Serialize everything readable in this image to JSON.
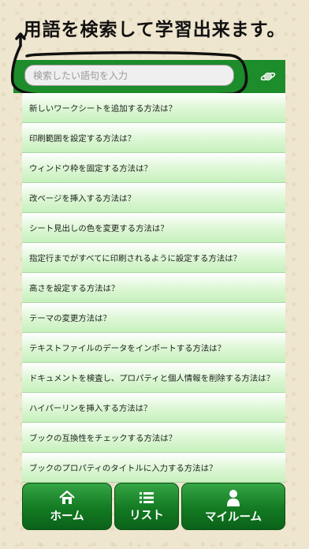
{
  "headline": "用語を検索して学習出来ます。",
  "search": {
    "placeholder": "検索したい語句を入力",
    "button_icon": "planet-icon"
  },
  "items": [
    "新しいワークシートを追加する方法は？",
    "印刷範囲を設定する方法は？",
    "ウィンドウ枠を固定する方法は？",
    "改ページを挿入する方法は？",
    "シート見出しの色を変更する方法は？",
    "指定行までがすべてに印刷されるように設定する方法は？",
    "高さを設定する方法は？",
    "テーマの変更方法は？",
    "テキストファイルのデータをインポートする方法は？",
    "ドキュメントを検査し、プロパティと個人情報を削除する方法は？",
    "ハイパーリンを挿入する方法は？",
    "ブックの互換性をチェックする方法は？",
    "ブックのプロパティのタイトルに入力する方法は？"
  ],
  "tabs": [
    {
      "label": "ホーム",
      "icon": "home-icon"
    },
    {
      "label": "リスト",
      "icon": "list-icon"
    },
    {
      "label": "マイルーム",
      "icon": "person-icon"
    }
  ],
  "colors": {
    "accent_green": "#1d8c2b",
    "list_green": "#c7f0bd",
    "paper": "#efe6cf"
  }
}
